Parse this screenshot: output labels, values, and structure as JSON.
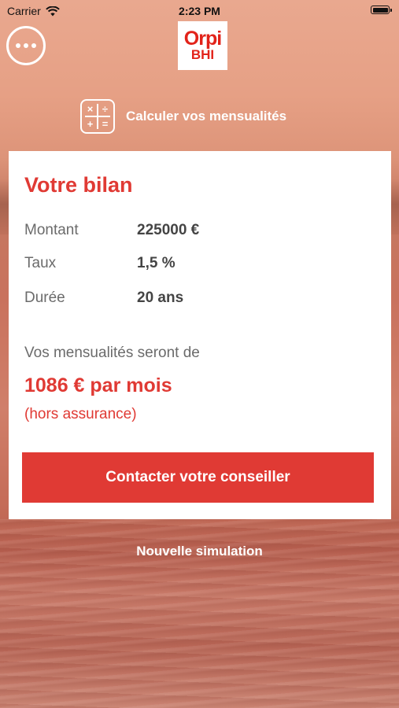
{
  "status_bar": {
    "carrier": "Carrier",
    "time": "2:23 PM"
  },
  "logo": {
    "main": "Orpi",
    "sub": "BHI"
  },
  "header": {
    "title": "Calculer vos mensualités",
    "icon": "calculator-icon"
  },
  "card": {
    "title": "Votre bilan",
    "rows": [
      {
        "label": "Montant",
        "value": "225000 €"
      },
      {
        "label": "Taux",
        "value": "1,5 %"
      },
      {
        "label": "Durée",
        "value": "20 ans"
      }
    ],
    "monthly_intro": "Vos mensualités seront de",
    "monthly_amount": "1086 € par mois",
    "monthly_note": "(hors assurance)",
    "contact_button": "Contacter votre conseiller"
  },
  "new_simulation": "Nouvelle simulation",
  "colors": {
    "accent": "#e03a34",
    "logo_red": "#e2231a"
  }
}
